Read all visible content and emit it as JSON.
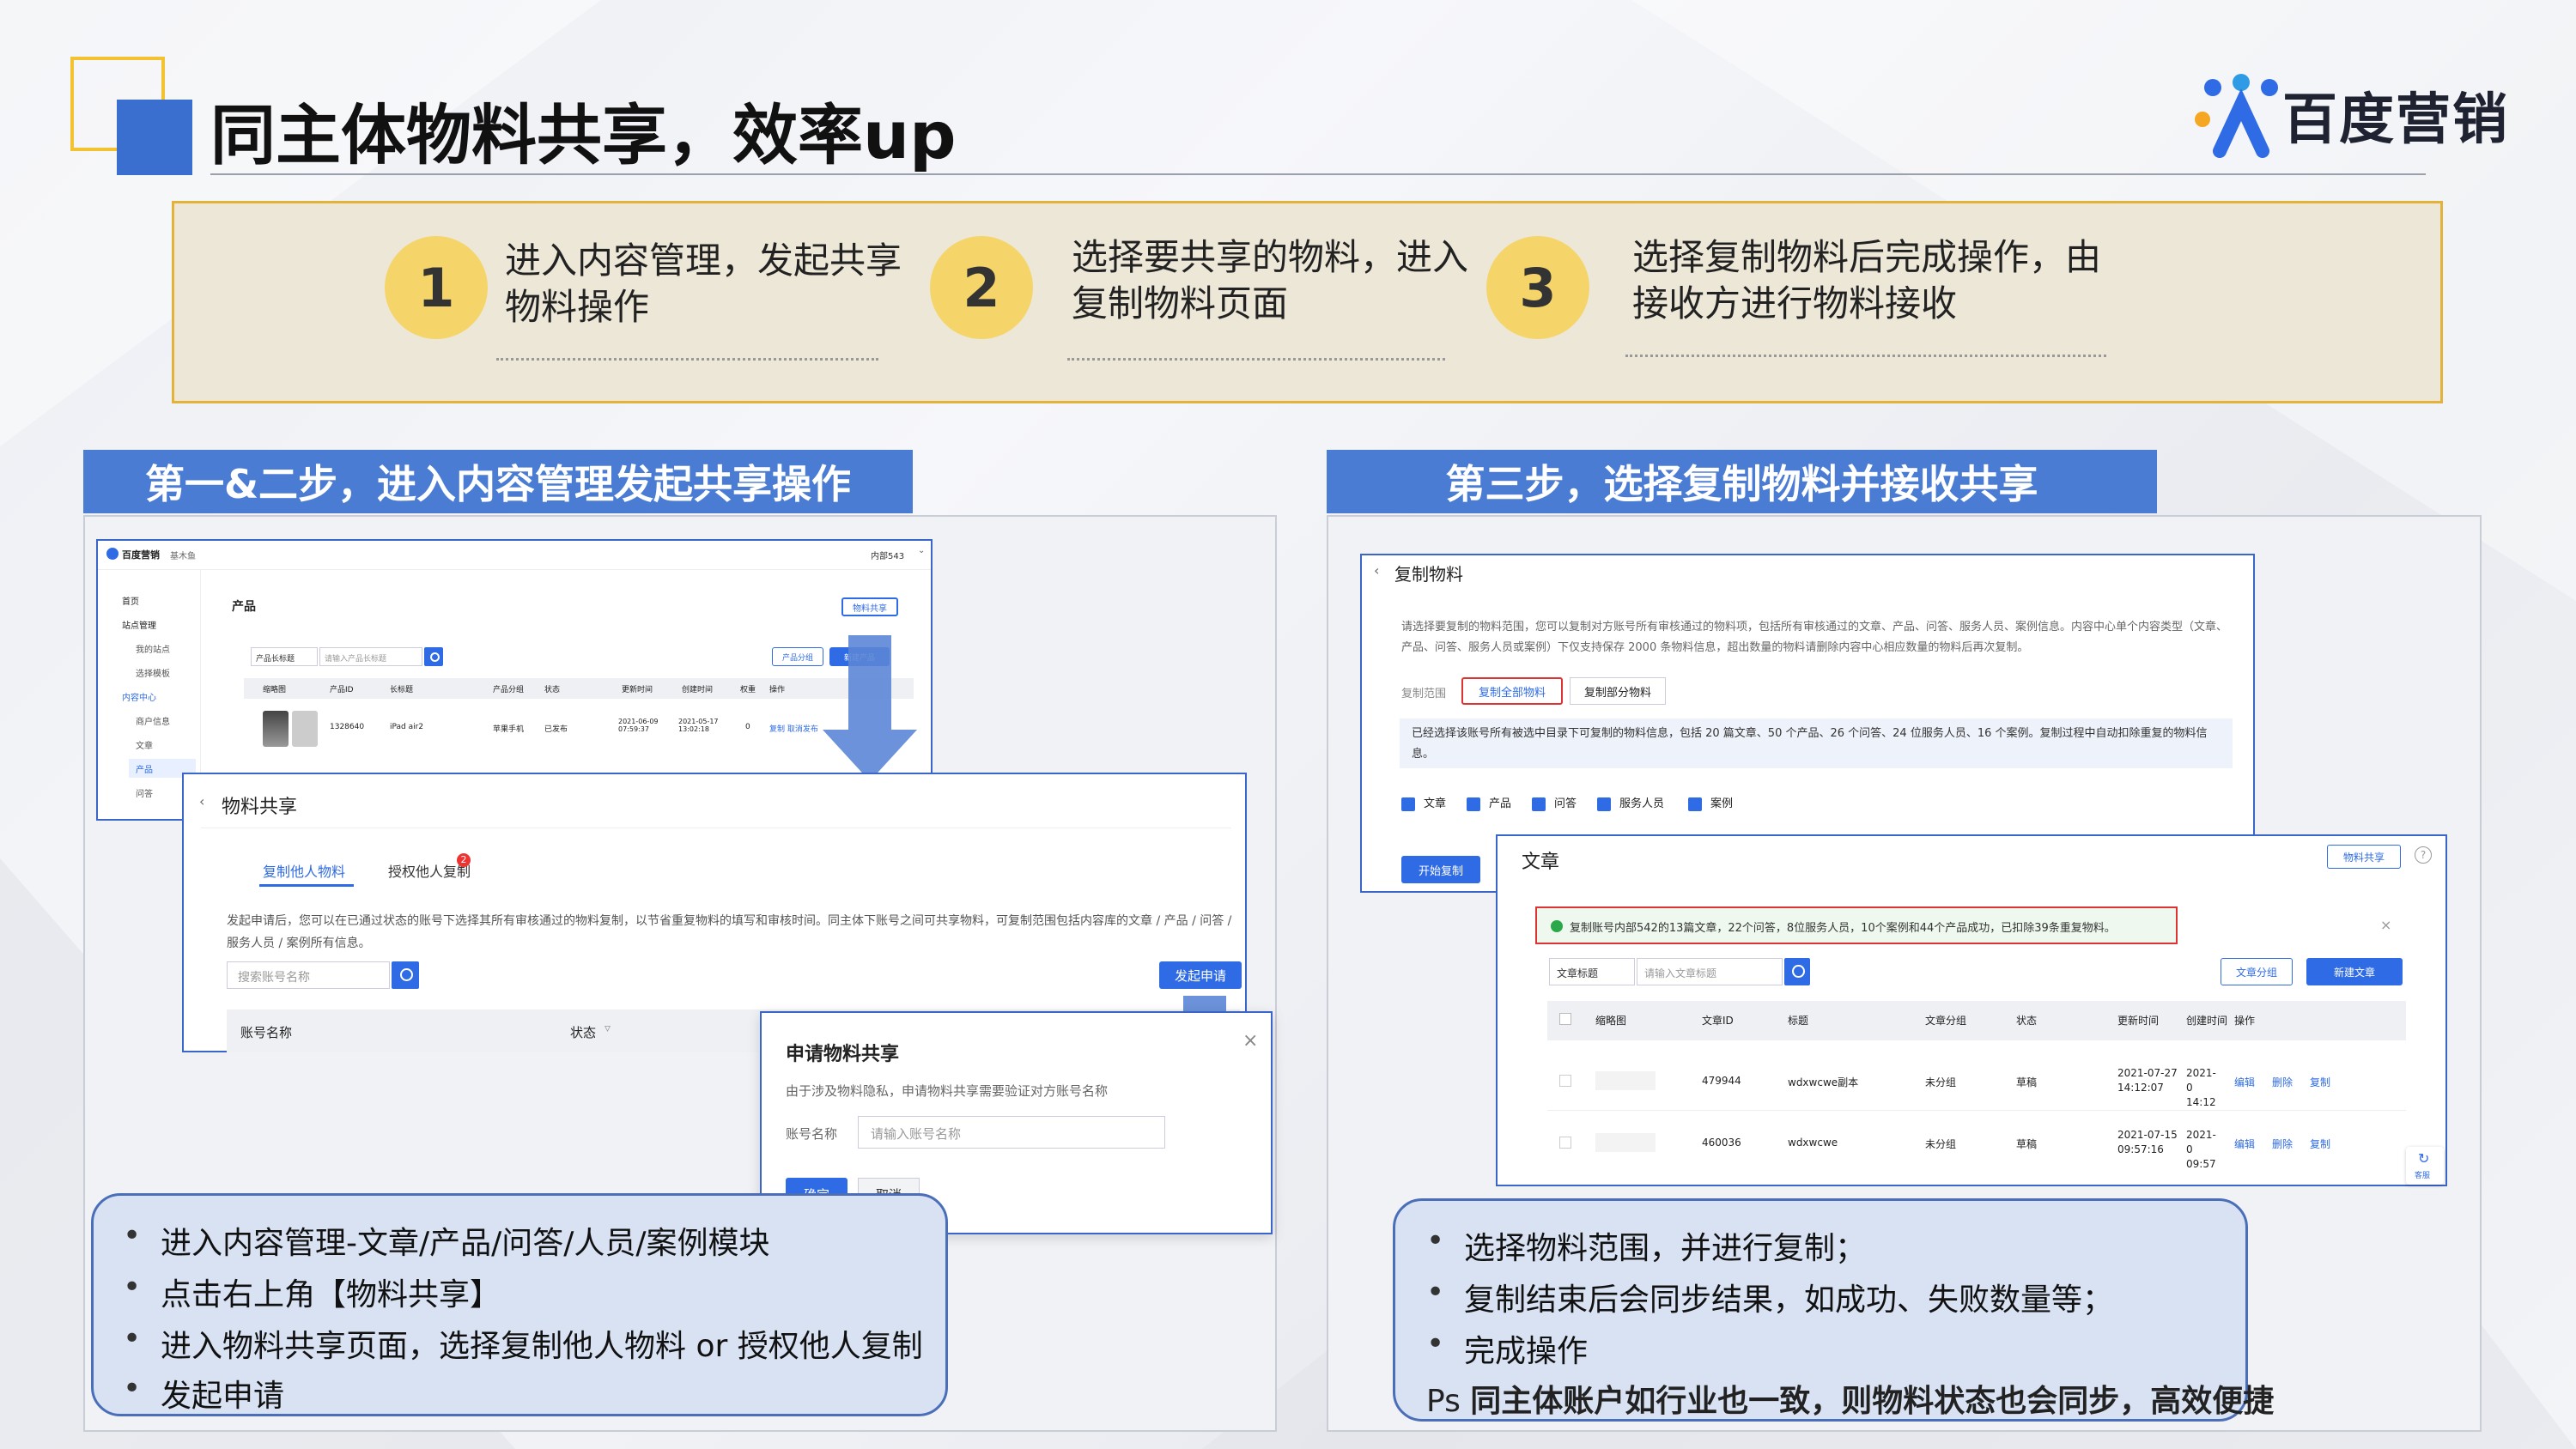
{
  "header": {
    "title": "同主体物料共享，效率up",
    "logo_text": "百度营销",
    "accent_color": "#3a6fd0",
    "highlight_color": "#f2c230"
  },
  "steps": [
    {
      "num": "1",
      "text": "进入内容管理，发起共享物料操作"
    },
    {
      "num": "2",
      "text": "选择要共享的物料，进入复制物料页面"
    },
    {
      "num": "3",
      "text": "选择复制物料后完成操作，由接收方进行物料接收"
    }
  ],
  "left_section": {
    "title": "第一&二步，进入内容管理发起共享操作",
    "console": {
      "brand": "百度营销",
      "brand_sub": "基木鱼",
      "account": "内部543",
      "nav": [
        "首页",
        "站点管理",
        "我的站点",
        "选择模板",
        "内容中心",
        "商户信息",
        "文章",
        "产品",
        "问答"
      ],
      "page_title": "产品",
      "share_button": "物料共享",
      "filter_select": "产品长标题",
      "filter_placeholder": "请输入产品长标题",
      "group_button": "产品分组",
      "new_button": "新建产品",
      "columns": [
        "缩略图",
        "产品ID",
        "长标题",
        "产品分组",
        "状态",
        "更新时间",
        "创建时间",
        "权重",
        "操作"
      ],
      "row": {
        "id": "1328640",
        "title": "iPad air2",
        "group": "苹果手机",
        "status": "已发布",
        "updated": "2021-06-09 07:59:37",
        "created": "2021-05-17 13:02:18",
        "weight": "0",
        "actions": "复制  取消发布"
      }
    },
    "share_page": {
      "title": "物料共享",
      "tab_copy": "复制他人物料",
      "tab_auth": "授权他人复制",
      "tab_badge": "2",
      "desc": "发起申请后，您可以在已通过状态的账号下选择其所有审核通过的物料复制，以节省重复物料的填写和审核时间。同主体下账号之间可共享物料，可复制范围包括内容库的文章 / 产品 / 问答 / 服务人员 / 案例所有信息。",
      "search_placeholder": "搜索账号名称",
      "apply_button": "发起申请",
      "col_account": "账号名称",
      "col_status": "状态"
    },
    "apply_dialog": {
      "title": "申请物料共享",
      "desc": "由于涉及物料隐私，申请物料共享需要验证对方账号名称",
      "field_label": "账号名称",
      "field_placeholder": "请输入账号名称",
      "ok": "确定",
      "cancel": "取消"
    },
    "bullets": [
      "进入内容管理-文章/产品/问答/人员/案例模块",
      "点击右上角【物料共享】",
      "进入物料共享页面，选择复制他人物料 or 授权他人复制",
      "发起申请"
    ]
  },
  "right_section": {
    "title": "第三步，选择复制物料并接收共享",
    "copy_page": {
      "title": "复制物料",
      "desc": "请选择要复制的物料范围，您可以复制对方账号所有审核通过的物料项，包括所有审核通过的文章、产品、问答、服务人员、案例信息。内容中心单个内容类型（文章、产品、问答、服务人员或案例）下仅支持保存 2000 条物料信息，超出数量的物料请删除内容中心相应数量的物料后再次复制。",
      "range_label": "复制范围",
      "copy_all": "复制全部物料",
      "copy_part": "复制部分物料",
      "info": "已经选择该账号所有被选中目录下可复制的物料信息，包括 20 篇文章、50 个产品、26 个问答、24 位服务人员、16 个案例。复制过程中自动扣除重复的物料信息。",
      "checks": [
        "文章",
        "产品",
        "问答",
        "服务人员",
        "案例"
      ],
      "start_button": "开始复制"
    },
    "article_page": {
      "title": "文章",
      "share_button": "物料共享",
      "notice": "复制账号内部542的13篇文章，22个问答，8位服务人员，10个案例和44个产品成功，已扣除39条重复物料。",
      "filter_select": "文章标题",
      "filter_placeholder": "请输入文章标题",
      "group_button": "文章分组",
      "new_button": "新建文章",
      "columns": [
        "缩略图",
        "文章ID",
        "标题",
        "文章分组",
        "状态",
        "更新时间",
        "创建时间",
        "操作"
      ],
      "rows": [
        {
          "id": "479944",
          "title": "wdxwcwe副本",
          "group": "未分组",
          "status": "草稿",
          "updated": "2021-07-27 14:12:07",
          "created": "2021-0 14:12:",
          "actions": [
            "编辑",
            "删除",
            "复制"
          ]
        },
        {
          "id": "460036",
          "title": "wdxwcwe",
          "group": "未分组",
          "status": "草稿",
          "updated": "2021-07-15 09:57:16",
          "created": "2021-0 09:57:",
          "actions": [
            "编辑",
            "删除",
            "复制"
          ]
        }
      ],
      "float_label": "客服"
    },
    "bullets": [
      "选择物料范围，并进行复制；",
      "复制结束后会同步结果，如成功、失败数量等；",
      "完成操作"
    ],
    "ps_prefix": "Ps",
    "ps_text": "同主体账户如行业也一致，则物料状态也会同步，高效便捷"
  }
}
